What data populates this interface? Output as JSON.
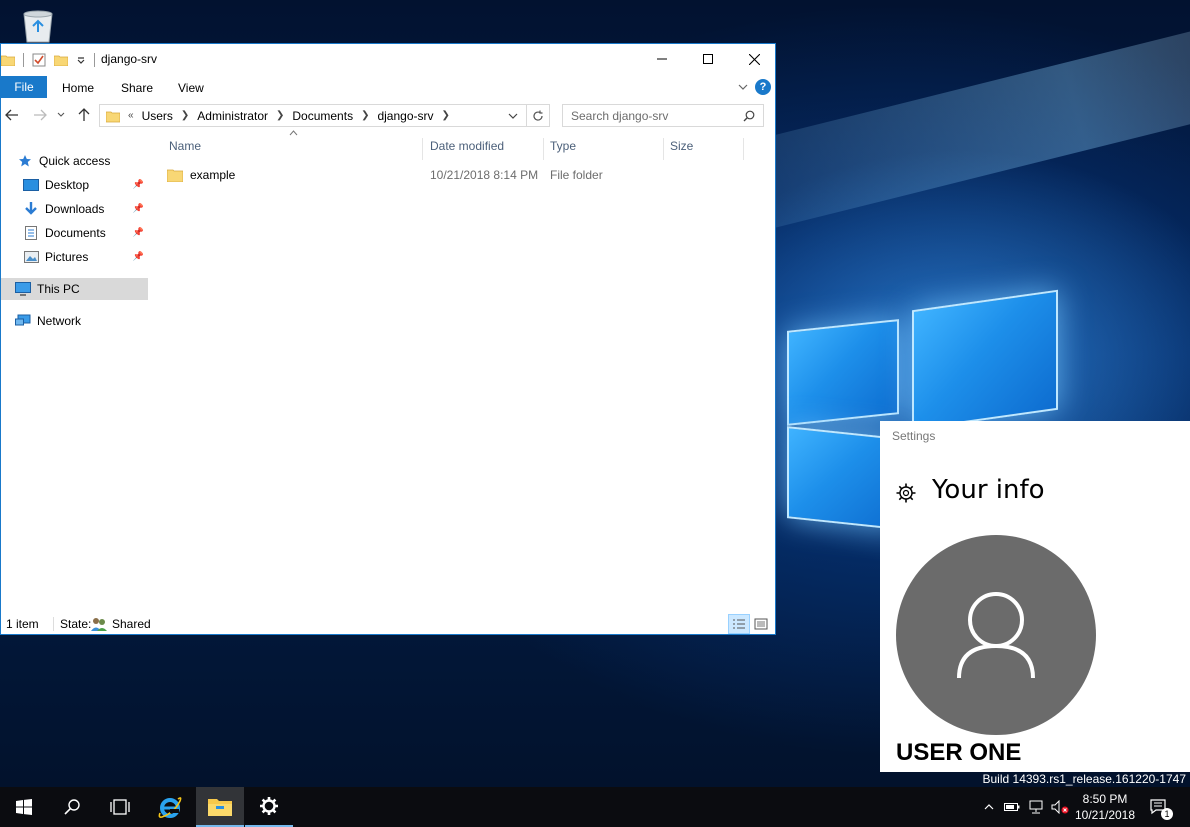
{
  "desktop": {
    "build_text": "Build 14393.rs1_release.161220-1747"
  },
  "explorer": {
    "title": "django-srv",
    "ribbon_tabs": [
      "File",
      "Home",
      "Share",
      "View"
    ],
    "address_prefix": "«",
    "breadcrumbs": [
      "Users",
      "Administrator",
      "Documents",
      "django-srv"
    ],
    "search_placeholder": "Search django-srv",
    "nav": {
      "quick_access": "Quick access",
      "pinned": [
        "Desktop",
        "Downloads",
        "Documents",
        "Pictures"
      ],
      "this_pc": "This PC",
      "network": "Network"
    },
    "columns": [
      "Name",
      "Date modified",
      "Type",
      "Size"
    ],
    "files": [
      {
        "name": "example",
        "date_modified": "10/21/2018 8:14 PM",
        "type": "File folder",
        "size": ""
      }
    ],
    "status": {
      "item_count": "1 item",
      "state_label": "State:",
      "state_value": "Shared"
    }
  },
  "settings": {
    "app_name": "Settings",
    "page_title": "Your info",
    "user_name": "USER ONE"
  },
  "taskbar": {
    "time": "8:50 PM",
    "date": "10/21/2018",
    "notification_count": "1"
  },
  "colors": {
    "accent": "#1979ca",
    "avatar_bg": "#6b6b6b",
    "taskbar_bg": "#0b0c10"
  }
}
